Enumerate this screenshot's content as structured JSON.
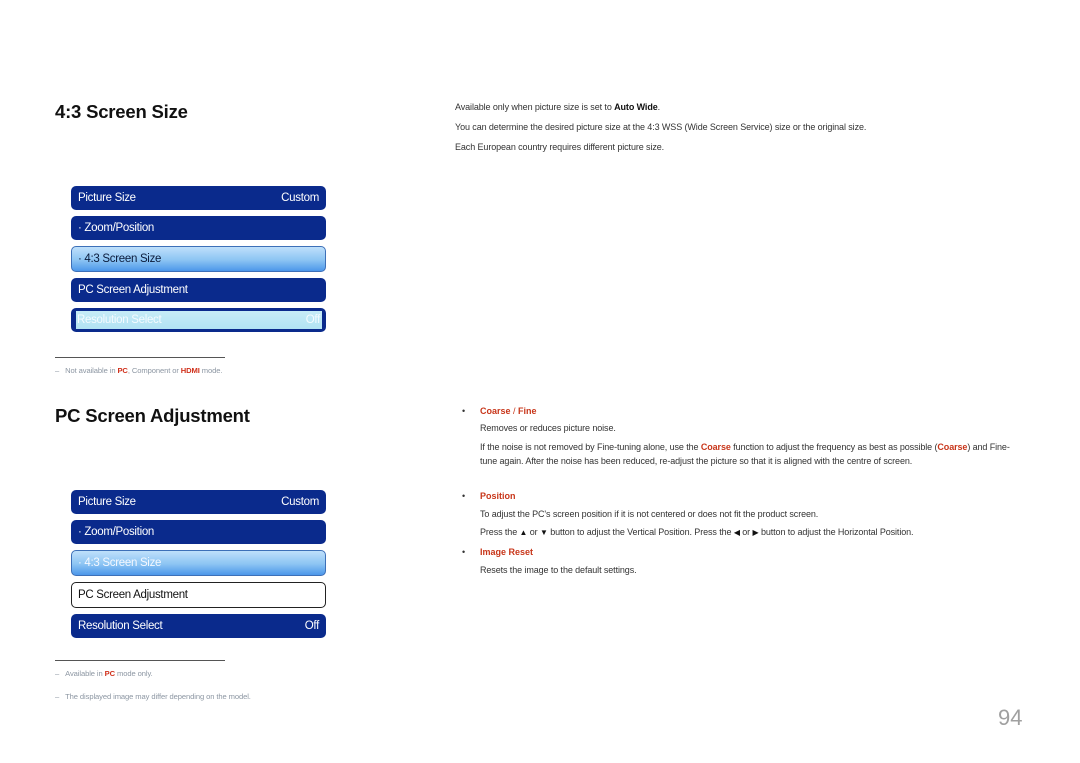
{
  "section1": {
    "title": "4:3 Screen Size",
    "menu": [
      {
        "label": "Picture Size",
        "value": "Custom",
        "state": "dark"
      },
      {
        "label": "· Zoom/Position",
        "value": "",
        "state": "dark"
      },
      {
        "label": "· 4:3 Screen Size",
        "value": "",
        "state": "highlighted"
      },
      {
        "label": "PC Screen Adjustment",
        "value": "",
        "state": "dark"
      },
      {
        "label": "Resolution Select",
        "value": "Off",
        "state": "disabled"
      }
    ],
    "note": {
      "prefix": "Not available in ",
      "pc": "PC",
      "middle": ", Component or ",
      "hdmi": "HDMI",
      "suffix": " mode."
    },
    "description": {
      "line1_prefix": "Available only when picture size is set to ",
      "line1_bold": "Auto Wide",
      "line1_suffix": ".",
      "line2": "You can determine the desired picture size at the 4:3 WSS (Wide Screen Service) size or the original size.",
      "line3": "Each European country requires different picture size."
    }
  },
  "section2": {
    "title": "PC Screen Adjustment",
    "menu": [
      {
        "label": "Picture Size",
        "value": "Custom",
        "state": "dark"
      },
      {
        "label": "· Zoom/Position",
        "value": "",
        "state": "dark"
      },
      {
        "label": "· 4:3 Screen Size",
        "value": "",
        "state": "faded"
      },
      {
        "label": "PC Screen Adjustment",
        "value": "",
        "state": "selected"
      },
      {
        "label": "Resolution Select",
        "value": "Off",
        "state": "dark"
      }
    ],
    "notes": [
      {
        "prefix": "Available in ",
        "pc": "PC",
        "suffix": " mode only."
      },
      {
        "text": "The displayed image may differ depending on the model."
      }
    ],
    "bullets": {
      "coarse_fine": {
        "head_a": "Coarse",
        "head_sep": " / ",
        "head_b": "Fine",
        "line1": "Removes or reduces picture noise.",
        "line2_a": "If the noise is not removed by Fine-tuning alone, use the ",
        "line2_coarse": "Coarse",
        "line2_b": " function to adjust the frequency as best as possible (",
        "line2_coarse2": "Coarse",
        "line2_c": ") and Fine-tune again. After the noise has been reduced, re-adjust the picture so that it is aligned with the centre of screen."
      },
      "position": {
        "head": "Position",
        "line1": "To adjust the PC's screen position if it is not centered or does not fit the product screen.",
        "line2_a": "Press the ",
        "up": "▲",
        "or1": " or ",
        "down": "▼",
        "line2_b": " button to adjust the Vertical Position. Press the ",
        "left": "◀",
        "or2": " or ",
        "right": "▶",
        "line2_c": " button to adjust the Horizontal Position."
      },
      "image_reset": {
        "head": "Image Reset",
        "line1": "Resets the image to the default settings."
      },
      "bullet_char": "•"
    }
  },
  "note_dash": "–",
  "page_number": "94"
}
